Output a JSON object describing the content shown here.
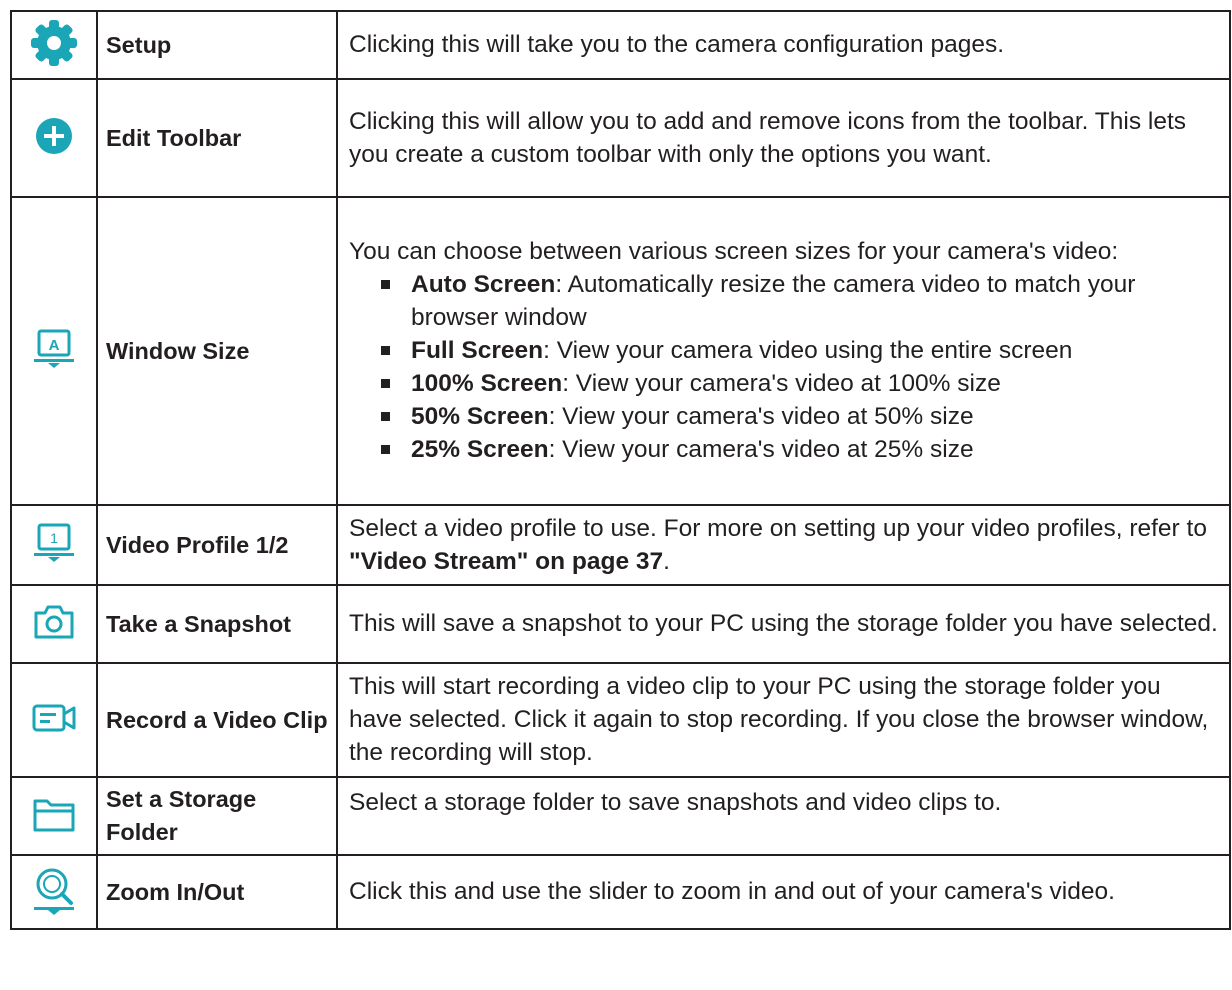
{
  "colors": {
    "icon_accent": "#1aa6b7",
    "border": "#231f20",
    "text": "#231f20"
  },
  "rows": [
    {
      "icon": "gear-icon",
      "name": "Setup",
      "description": "Clicking this will take you to the camera configuration pages."
    },
    {
      "icon": "plus-circle-icon",
      "name": "Edit Toolbar",
      "description": "Clicking this will allow you to add and remove icons from the toolbar. This lets you create a custom toolbar with only the options you want."
    },
    {
      "icon": "window-size-icon",
      "icon_glyph": "A",
      "name": "Window Size",
      "description": "You can choose between various screen sizes for your camera's video:",
      "bullets": [
        {
          "term": "Auto Screen",
          "text": ": Automatically resize the camera video to match your browser window"
        },
        {
          "term": "Full Screen",
          "text": ": View your camera video using the entire screen"
        },
        {
          "term": "100% Screen",
          "text": ": View your camera's video at 100% size"
        },
        {
          "term": "50% Screen",
          "text": ": View your camera's video at 50% size"
        },
        {
          "term": "25% Screen",
          "text": ": View your camera's video at 25% size"
        }
      ]
    },
    {
      "icon": "video-profile-icon",
      "icon_glyph": "1",
      "name": "Video Profile 1/2",
      "description_pre": "Select a video profile to use. For more on setting up your video profiles, refer to ",
      "description_ref": "\"Video Stream\" on page 37",
      "description_post": "."
    },
    {
      "icon": "camera-icon",
      "name": "Take a Snapshot",
      "description": "This will save a snapshot to your PC using the storage folder you have selected."
    },
    {
      "icon": "video-camera-icon",
      "name": "Record a Video Clip",
      "description": "This will start recording a video clip to your PC using the storage folder you have selected. Click it again to stop recording. If you close the browser window, the recording will stop."
    },
    {
      "icon": "folder-icon",
      "name": "Set a Storage Folder",
      "description": "Select a storage folder to save snapshots and video clips to."
    },
    {
      "icon": "zoom-icon",
      "name": "Zoom In/Out",
      "description": "Click this and use the slider to zoom in and out of your camera's video."
    }
  ]
}
